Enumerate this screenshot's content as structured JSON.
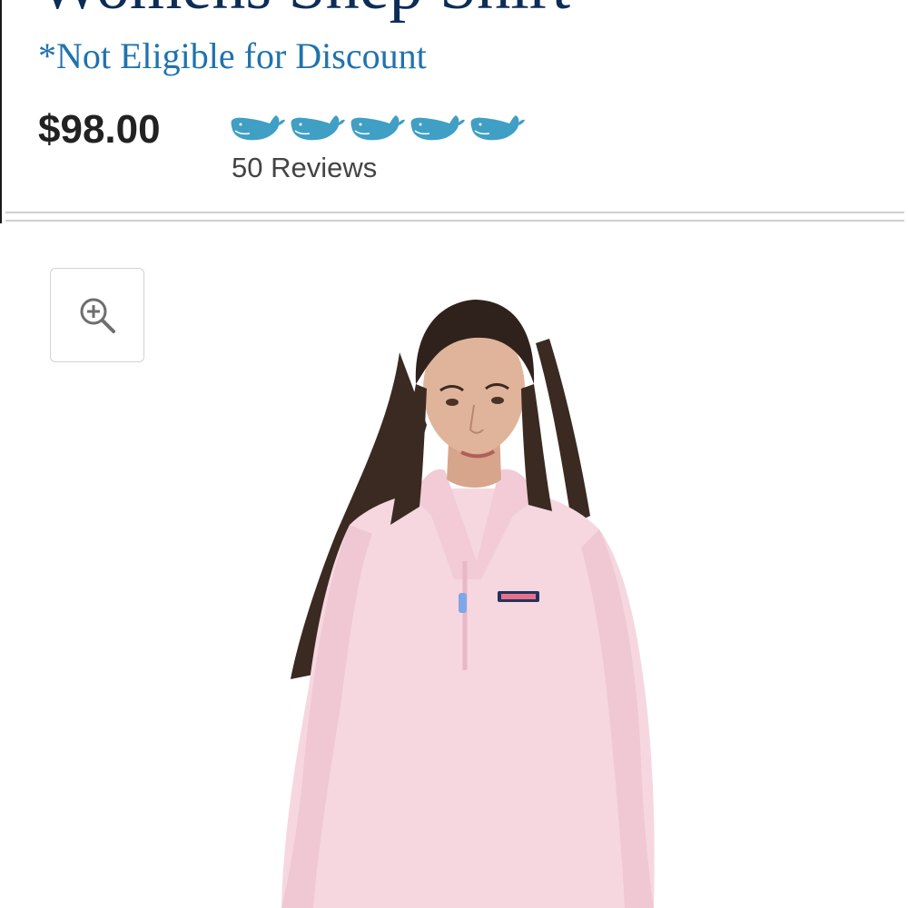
{
  "product": {
    "title": "Womens Shep Shirt",
    "discount_note": "*Not Eligible for Discount",
    "price": "$98.00",
    "rating": {
      "value": 5,
      "max": 5,
      "icon": "whale-icon",
      "color": "#3f9fc4"
    },
    "reviews_label": "50 Reviews"
  },
  "gallery": {
    "zoom_icon": "zoom-in-icon",
    "garment_color": "#f6d7e0"
  },
  "colors": {
    "title": "#0c2d57",
    "discount": "#1f72ae",
    "price": "#222222",
    "divider": "#cfcfcf"
  }
}
